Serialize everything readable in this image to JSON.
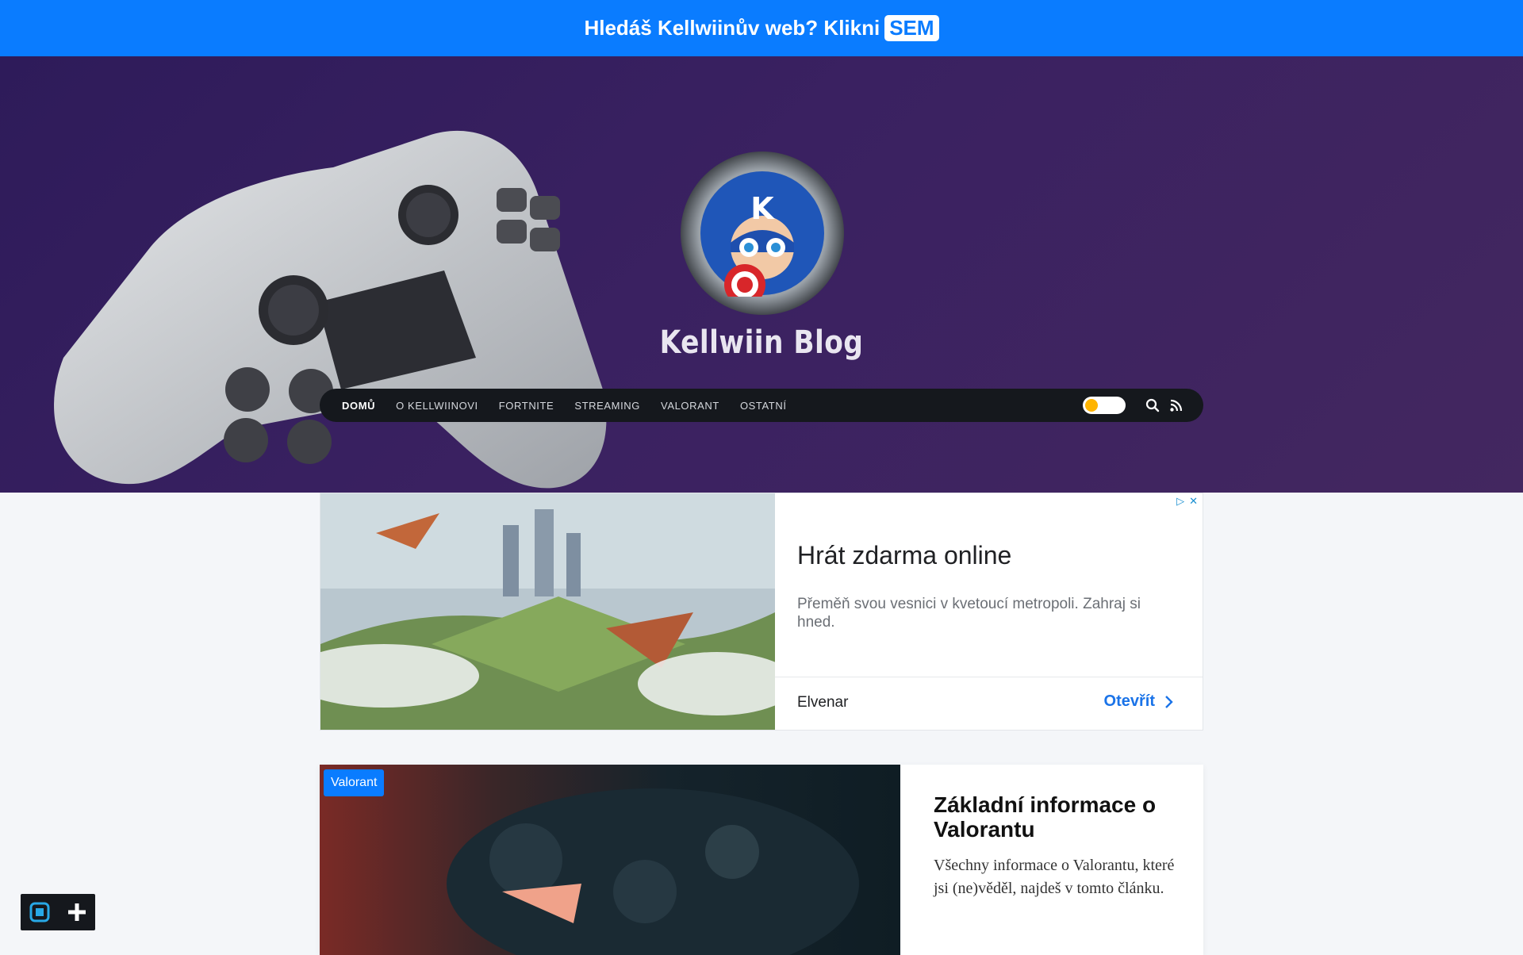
{
  "banner": {
    "text": "Hledáš Kellwiinův web? Klikni",
    "link_label": "SEM"
  },
  "header": {
    "site_title": "Kellwiin Blog",
    "logo_letter": "K"
  },
  "nav": {
    "items": [
      {
        "label": "DOMŮ",
        "active": true
      },
      {
        "label": "O KELLWIINOVI",
        "active": false
      },
      {
        "label": "FORTNITE",
        "active": false
      },
      {
        "label": "STREAMING",
        "active": false
      },
      {
        "label": "VALORANT",
        "active": false
      },
      {
        "label": "OSTATNÍ",
        "active": false
      }
    ],
    "icons": [
      "theme-toggle",
      "search-icon",
      "rss-icon"
    ]
  },
  "ad": {
    "title": "Hrát zdarma online",
    "description": "Přeměň svou vesnici v kvetoucí metropoli. Zahraj si hned.",
    "brand": "Elvenar",
    "cta": "Otevřít"
  },
  "article": {
    "category": "Valorant",
    "title": "Základní informace o Valorantu",
    "excerpt": "Všechny informace o Valorantu, které jsi (ne)věděl, najdeš v tomto článku."
  },
  "colors": {
    "accent": "#0a7cff",
    "hero": "#3a2161",
    "navbar": "#15181d",
    "toggle_knob": "#ffb400"
  }
}
